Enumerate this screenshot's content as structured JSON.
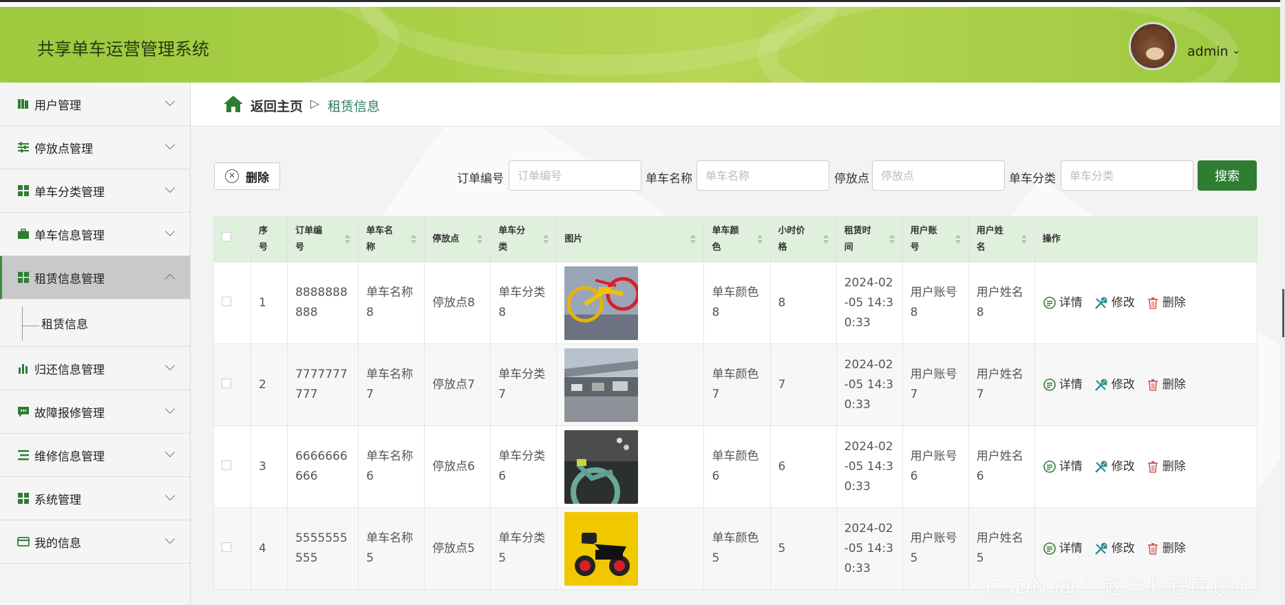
{
  "app": {
    "title": "共享单车运营管理系统",
    "user": "admin"
  },
  "sidebar": {
    "items": [
      {
        "label": "用户管理",
        "icon": "book-icon",
        "active": false
      },
      {
        "label": "停放点管理",
        "icon": "sliders-icon",
        "active": false
      },
      {
        "label": "单车分类管理",
        "icon": "grid-icon",
        "active": false
      },
      {
        "label": "单车信息管理",
        "icon": "briefcase-icon",
        "active": false
      },
      {
        "label": "租赁信息管理",
        "icon": "grid-icon",
        "active": true
      },
      {
        "label": "归还信息管理",
        "icon": "bar-chart-icon",
        "active": false
      },
      {
        "label": "故障报修管理",
        "icon": "chat-icon",
        "active": false
      },
      {
        "label": "维修信息管理",
        "icon": "list-icon",
        "active": false
      },
      {
        "label": "系统管理",
        "icon": "grid-icon",
        "active": false
      },
      {
        "label": "我的信息",
        "icon": "card-icon",
        "active": false
      }
    ],
    "submenu": {
      "label": "租赁信息"
    }
  },
  "breadcrumb": {
    "home": "返回主页",
    "separator": "▷",
    "current": "租赁信息"
  },
  "toolbar": {
    "delete_label": "删除",
    "search_label": "搜索"
  },
  "search": {
    "fields": [
      {
        "label": "订单编号",
        "placeholder": "订单编号"
      },
      {
        "label": "单车名称",
        "placeholder": "单车名称"
      },
      {
        "label": "停放点",
        "placeholder": "停放点"
      },
      {
        "label": "单车分类",
        "placeholder": "单车分类"
      }
    ]
  },
  "table": {
    "headers": [
      "序号",
      "订单编\n号",
      "单车名\n称",
      "停放点",
      "单车分\n类",
      "图片",
      "单车颜\n色",
      "小时价\n格",
      "租赁时\n间",
      "用户账\n号",
      "用户姓\n名",
      "操作"
    ],
    "actions": {
      "detail": "详情",
      "edit": "修改",
      "delete": "删除"
    },
    "rows": [
      {
        "index": "1",
        "order": "8888888888",
        "name": "单车名称8",
        "spot": "停放点8",
        "category": "单车分类8",
        "image": "bike-yellow",
        "color": "单车颜色8",
        "price": "8",
        "time": "2024-02-05 14:30:33",
        "account": "用户账号8",
        "username": "用户姓名8"
      },
      {
        "index": "2",
        "order": "7777777777",
        "name": "单车名称7",
        "spot": "停放点7",
        "category": "单车分类7",
        "image": "parking-shed",
        "color": "单车颜色7",
        "price": "7",
        "time": "2024-02-05 14:30:33",
        "account": "用户账号7",
        "username": "用户姓名7"
      },
      {
        "index": "3",
        "order": "6666666666",
        "name": "单车名称6",
        "spot": "停放点6",
        "category": "单车分类6",
        "image": "bike-teal",
        "color": "单车颜色6",
        "price": "6",
        "time": "2024-02-05 14:30:33",
        "account": "用户账号6",
        "username": "用户姓名6"
      },
      {
        "index": "4",
        "order": "5555555555",
        "name": "单车名称5",
        "spot": "停放点5",
        "category": "单车分类5",
        "image": "scooter-yellow",
        "color": "单车颜色5",
        "price": "5",
        "time": "2024-02-05 14:30:33",
        "account": "用户账号5",
        "username": "用户姓名5"
      }
    ]
  },
  "watermark": "CSDN @ ゛赵学长程序设计",
  "colors": {
    "header": "#a8cf45",
    "primary": "#2e7d32",
    "table_header": "#dff0dc",
    "breadcrumb_current": "#2f7d5d"
  }
}
